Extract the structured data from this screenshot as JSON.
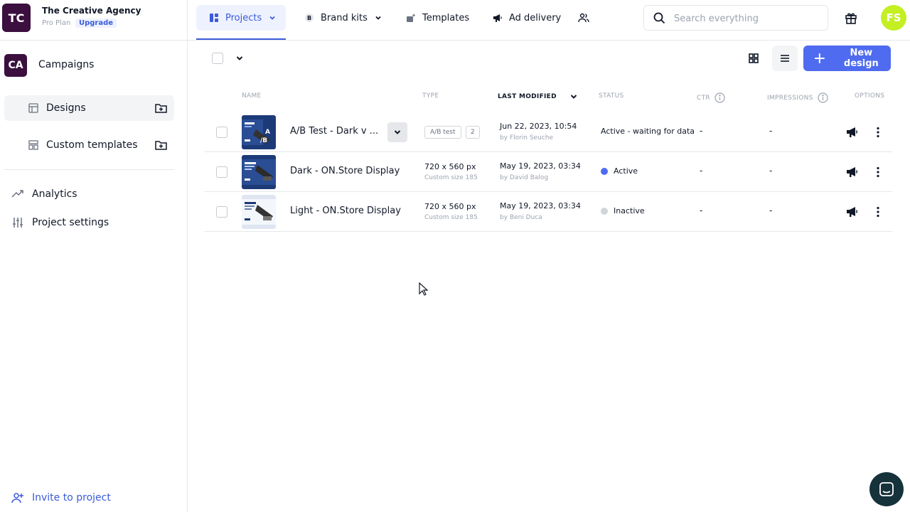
{
  "org": {
    "initials": "TC",
    "name": "The Creative Agency",
    "plan": "Pro Plan",
    "upgrade_label": "Upgrade"
  },
  "campaign": {
    "initials": "CA",
    "label": "Campaigns"
  },
  "sidebar": {
    "items": [
      {
        "label": "Designs",
        "icon": "layout-icon",
        "active": true
      },
      {
        "label": "Custom templates",
        "icon": "template-icon",
        "active": false
      }
    ],
    "links": [
      {
        "label": "Analytics",
        "icon": "trend-icon"
      },
      {
        "label": "Project settings",
        "icon": "sliders-icon"
      }
    ],
    "invite_label": "Invite to project"
  },
  "tabs": [
    {
      "label": "Projects",
      "active": true
    },
    {
      "label": "Brand kits",
      "active": false
    },
    {
      "label": "Templates",
      "active": false
    },
    {
      "label": "Ad delivery",
      "active": false
    }
  ],
  "search": {
    "placeholder": "Search everything",
    "value": ""
  },
  "user": {
    "initials": "FS",
    "color": "#c3ef23"
  },
  "toolbar": {
    "new_design_label": "New design"
  },
  "table": {
    "headers": {
      "name": "NAME",
      "type": "TYPE",
      "modified": "LAST MODIFIED",
      "status": "STATUS",
      "ctr": "CTR",
      "impressions": "IMPRESSIONS",
      "options": "OPTIONS"
    },
    "rows": [
      {
        "name": "A/B Test - Dark v ...",
        "type_badge": "A/B test",
        "type_count": "2",
        "modified": "Jun 22, 2023, 10:54",
        "by": "by Florin Seuche",
        "status": "Active - waiting for data",
        "ctr": "-",
        "impressions": "-"
      },
      {
        "name": "Dark - ON.Store Display",
        "type": "720 x 560 px",
        "type_sub": "Custom size 185",
        "modified": "May 19, 2023, 03:34",
        "by": "by David Balog",
        "status": "Active",
        "status_color": "#4f6bf0",
        "ctr": "-",
        "impressions": "-"
      },
      {
        "name": "Light - ON.Store Display",
        "type": "720 x 560 px",
        "type_sub": "Custom size 185",
        "modified": "May 19, 2023, 03:34",
        "by": "by Beni Duca",
        "status": "Inactive",
        "status_color": "#d1d5db",
        "ctr": "-",
        "impressions": "-"
      }
    ]
  },
  "colors": {
    "accent": "#4f6bf0",
    "brand": "#3b0f3e"
  }
}
